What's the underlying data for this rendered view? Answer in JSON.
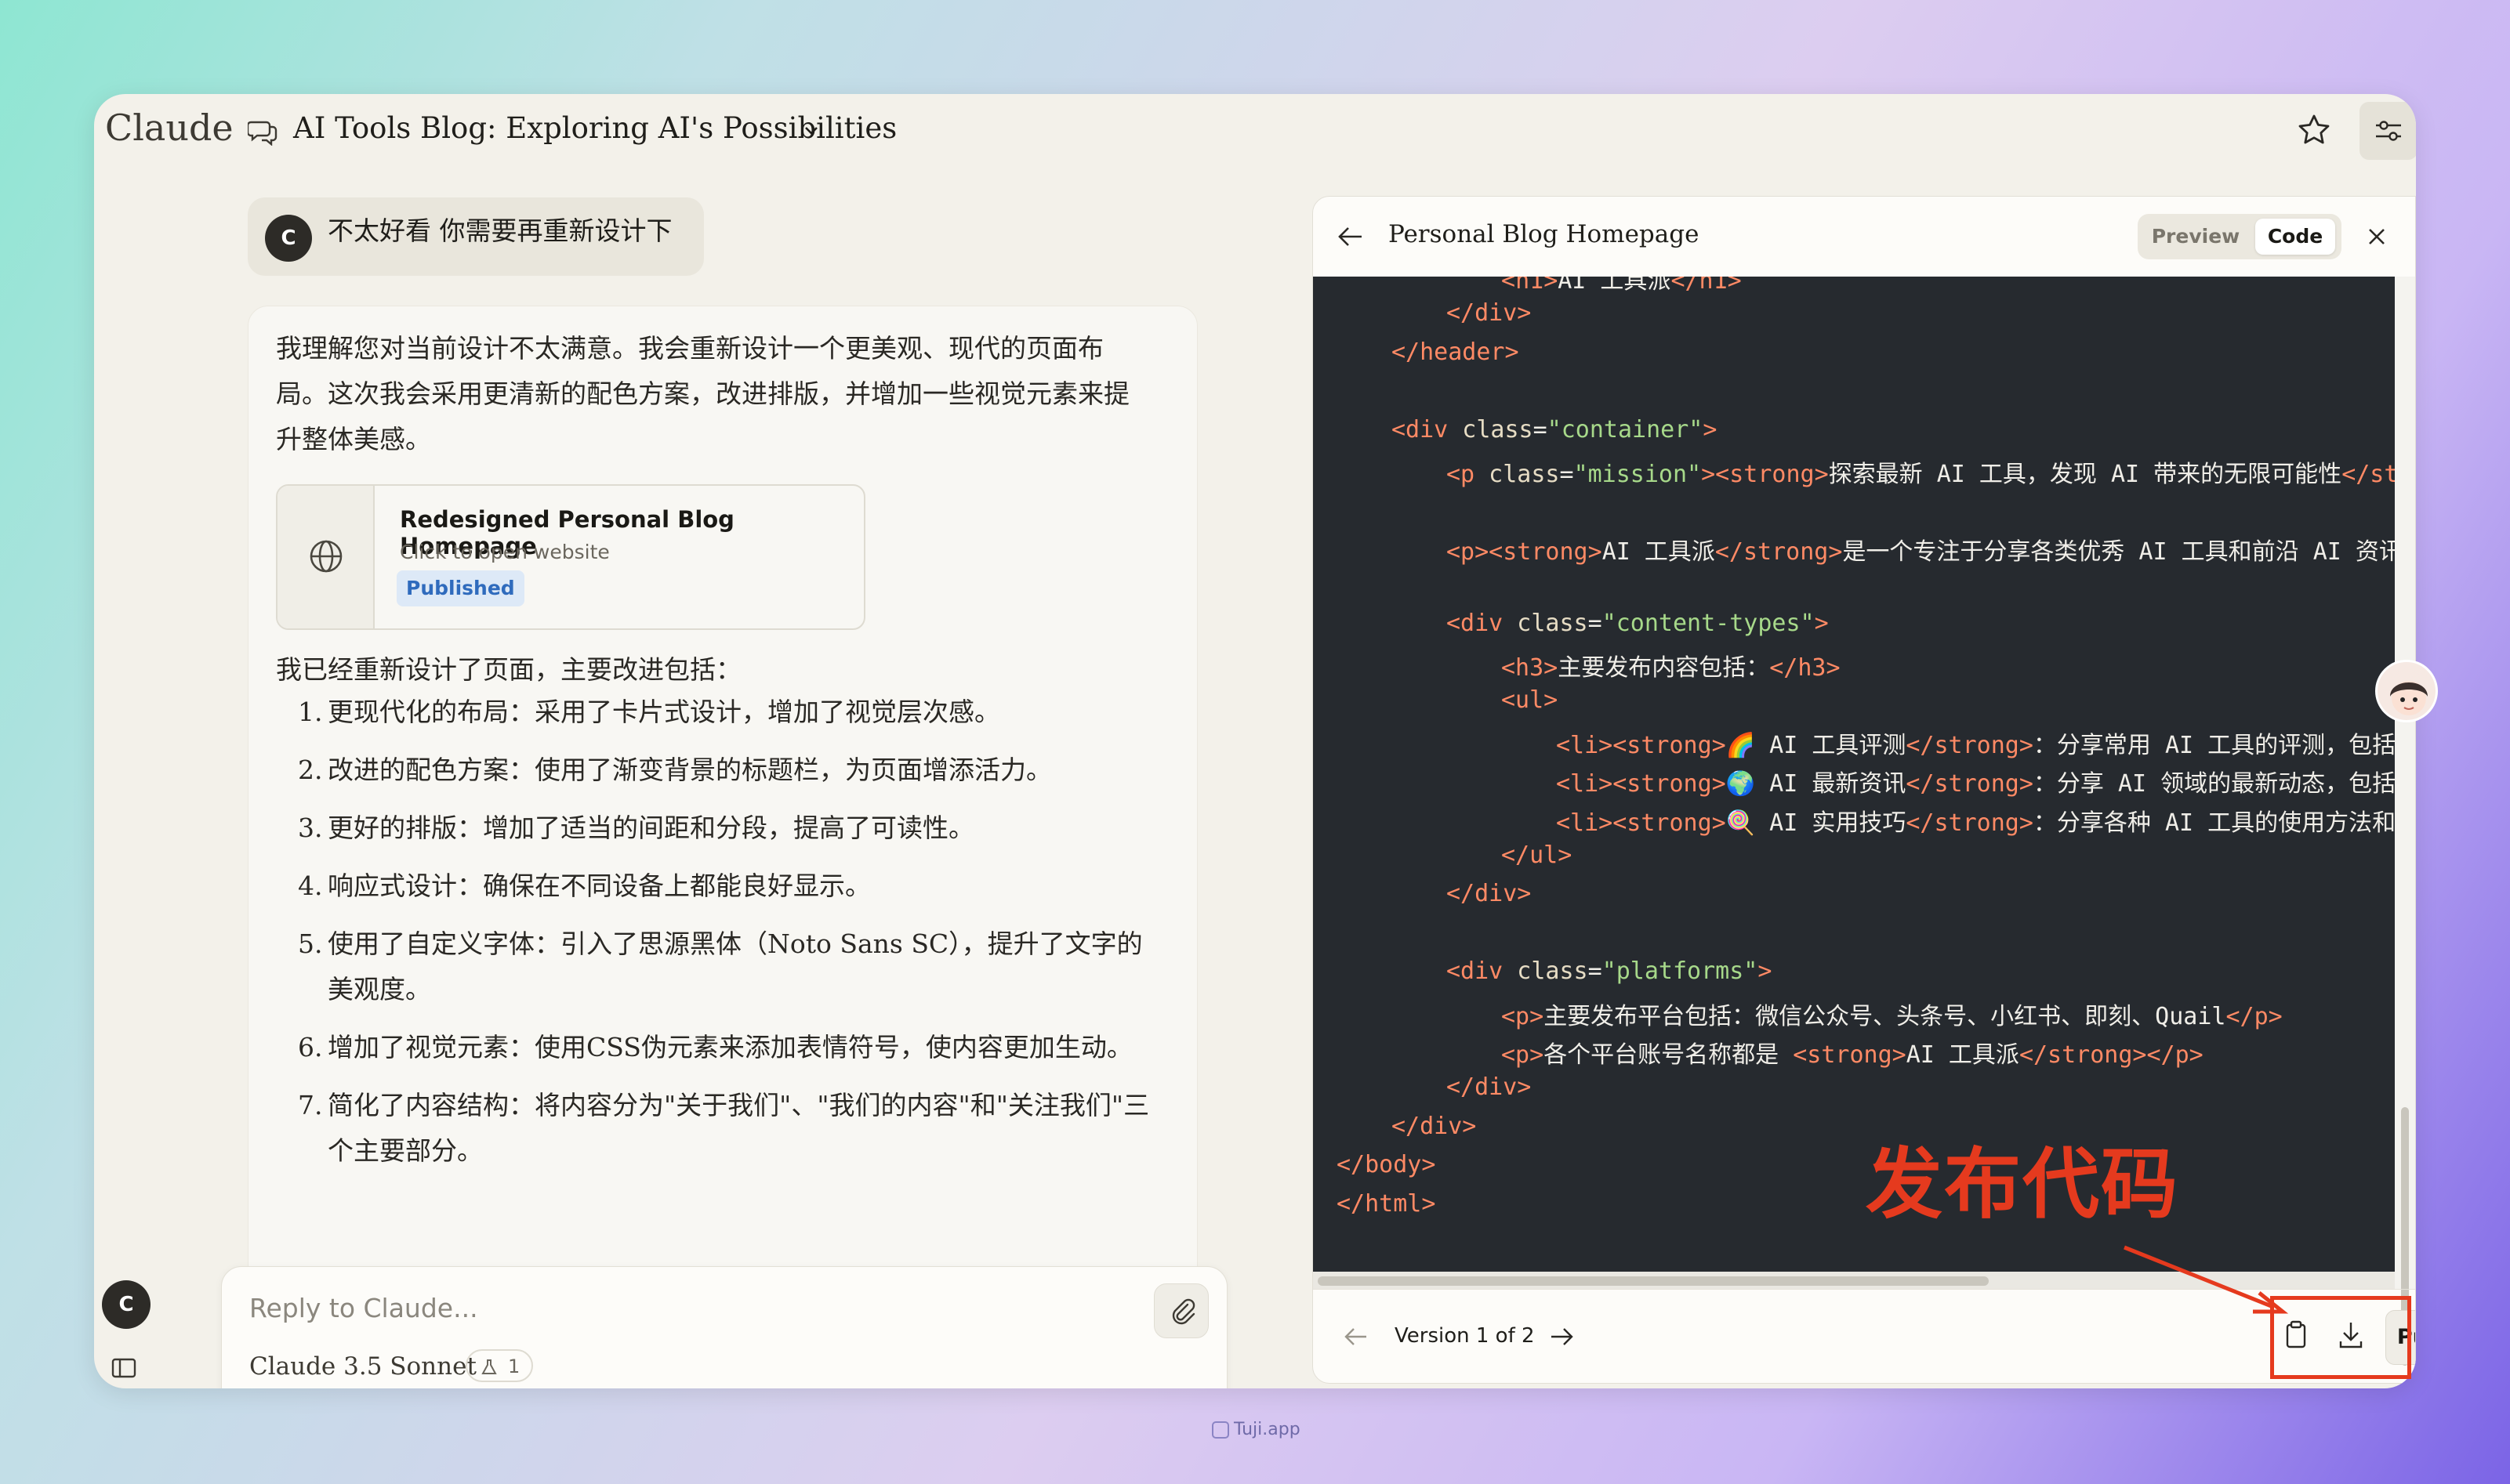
{
  "app": {
    "logo": "Claude",
    "conversation_title": "AI Tools Blog: Exploring AI's Possibilities"
  },
  "user_message": {
    "avatar_initial": "C",
    "text": "不太好看 你需要再重新设计下"
  },
  "assistant": {
    "intro": "我理解您对当前设计不太满意。我会重新设计一个更美观、现代的页面布局。这次我会采用更清新的配色方案，改进排版，并增加一些视觉元素来提升整体美感。",
    "artifact_card": {
      "title": "Redesigned Personal Blog Homepage",
      "subtitle": "Click to open website",
      "badge": "Published",
      "icon": "globe-icon"
    },
    "lead": "我已经重新设计了页面，主要改进包括：",
    "improvements": [
      {
        "num": "1.",
        "text": "更现代化的布局：采用了卡片式设计，增加了视觉层次感。"
      },
      {
        "num": "2.",
        "text": "改进的配色方案：使用了渐变背景的标题栏，为页面增添活力。"
      },
      {
        "num": "3.",
        "text": "更好的排版：增加了适当的间距和分段，提高了可读性。"
      },
      {
        "num": "4.",
        "text": "响应式设计：确保在不同设备上都能良好显示。"
      },
      {
        "num": "5.",
        "text": "使用了自定义字体：引入了思源黑体（Noto Sans SC），提升了文字的美观度。"
      },
      {
        "num": "6.",
        "text": "增加了视觉元素：使用CSS伪元素来添加表情符号，使内容更加生动。"
      },
      {
        "num": "7.",
        "text": "简化了内容结构：将内容分为\"关于我们\"、\"我们的内容\"和\"关注我们\"三个主要部分。"
      }
    ]
  },
  "composer": {
    "placeholder": "Reply to Claude...",
    "model": "Claude 3.5 Sonnet",
    "counter": "1",
    "user_initial": "C"
  },
  "artifact": {
    "title": "Personal Blog Homepage",
    "tab_preview": "Preview",
    "tab_code": "Code",
    "active_tab": "Code",
    "version": "Version 1 of 2",
    "publish_label": "Publish",
    "code_lines": [
      [
        {
          "t": "tag",
          "v": "<"
        },
        {
          "t": "tag",
          "v": "h1"
        },
        {
          "t": "tag",
          "v": ">"
        },
        {
          "t": "txt",
          "v": "AI 工具派"
        },
        {
          "t": "tag",
          "v": "</h1>"
        }
      ],
      [
        {
          "t": "tag",
          "v": "</div>"
        }
      ],
      [
        {
          "t": "tag",
          "v": "</header>"
        }
      ],
      [],
      [
        {
          "t": "tag",
          "v": "<div"
        },
        {
          "t": "attr",
          "v": " class"
        },
        {
          "t": "txt",
          "v": "="
        },
        {
          "t": "val",
          "v": "\"container\""
        },
        {
          "t": "tag",
          "v": ">"
        }
      ],
      [
        {
          "t": "tag",
          "v": "<p"
        },
        {
          "t": "attr",
          "v": " class"
        },
        {
          "t": "txt",
          "v": "="
        },
        {
          "t": "val",
          "v": "\"mission\""
        },
        {
          "t": "tag",
          "v": "><strong>"
        },
        {
          "t": "txt",
          "v": "探索最新 AI 工具，发现 AI 带来的无限可能性"
        },
        {
          "t": "tag",
          "v": "</strong></p>"
        }
      ],
      [],
      [
        {
          "t": "tag",
          "v": "<p><strong>"
        },
        {
          "t": "txt",
          "v": "AI 工具派"
        },
        {
          "t": "tag",
          "v": "</strong>"
        },
        {
          "t": "txt",
          "v": "是一个专注于分享各类优秀 AI 工具和前沿 AI 资讯的平台"
        }
      ],
      [],
      [
        {
          "t": "tag",
          "v": "<div"
        },
        {
          "t": "attr",
          "v": " class"
        },
        {
          "t": "txt",
          "v": "="
        },
        {
          "t": "val",
          "v": "\"content-types\""
        },
        {
          "t": "tag",
          "v": ">"
        }
      ],
      [
        {
          "t": "tag",
          "v": "<h3>"
        },
        {
          "t": "txt",
          "v": "主要发布内容包括："
        },
        {
          "t": "tag",
          "v": "</h3>"
        }
      ],
      [
        {
          "t": "tag",
          "v": "<ul>"
        }
      ],
      [
        {
          "t": "tag",
          "v": "<li><strong>"
        },
        {
          "t": "txt",
          "v": "🌈 AI 工具评测"
        },
        {
          "t": "tag",
          "v": "</strong>"
        },
        {
          "t": "txt",
          "v": "：分享常用 AI 工具的评测，包括工具介绍"
        }
      ],
      [
        {
          "t": "tag",
          "v": "<li><strong>"
        },
        {
          "t": "txt",
          "v": "🌍 AI 最新资讯"
        },
        {
          "t": "tag",
          "v": "</strong>"
        },
        {
          "t": "txt",
          "v": "：分享 AI 领域的最新动态，包括技术进展"
        }
      ],
      [
        {
          "t": "tag",
          "v": "<li><strong>"
        },
        {
          "t": "txt",
          "v": "🍭 AI 实用技巧"
        },
        {
          "t": "tag",
          "v": "</strong>"
        },
        {
          "t": "txt",
          "v": "：分享各种 AI 工具的使用方法和技巧"
        }
      ],
      [
        {
          "t": "tag",
          "v": "</ul>"
        }
      ],
      [
        {
          "t": "tag",
          "v": "</div>"
        }
      ],
      [],
      [
        {
          "t": "tag",
          "v": "<div"
        },
        {
          "t": "attr",
          "v": " class"
        },
        {
          "t": "txt",
          "v": "="
        },
        {
          "t": "val",
          "v": "\"platforms\""
        },
        {
          "t": "tag",
          "v": ">"
        }
      ],
      [
        {
          "t": "tag",
          "v": "<p>"
        },
        {
          "t": "txt",
          "v": "主要发布平台包括：微信公众号、头条号、小红书、即刻、Quail"
        },
        {
          "t": "tag",
          "v": "</p>"
        }
      ],
      [
        {
          "t": "tag",
          "v": "<p>"
        },
        {
          "t": "txt",
          "v": "各个平台账号名称都是 "
        },
        {
          "t": "tag",
          "v": "<strong>"
        },
        {
          "t": "txt",
          "v": "AI 工具派"
        },
        {
          "t": "tag",
          "v": "</strong></p>"
        }
      ],
      [
        {
          "t": "tag",
          "v": "</div>"
        }
      ],
      [
        {
          "t": "tag",
          "v": "</div>"
        }
      ],
      [
        {
          "t": "tag",
          "v": "</body>"
        }
      ],
      [
        {
          "t": "tag",
          "v": "</html>"
        }
      ]
    ]
  },
  "annotation": {
    "text": "发布代码",
    "color": "#e53a1e"
  },
  "watermark": "Tuji.app",
  "colors": {
    "code_bg": "#262a2f",
    "tag": "#ff8a65",
    "string": "#a7d98a",
    "accent_red": "#e53a1e"
  }
}
